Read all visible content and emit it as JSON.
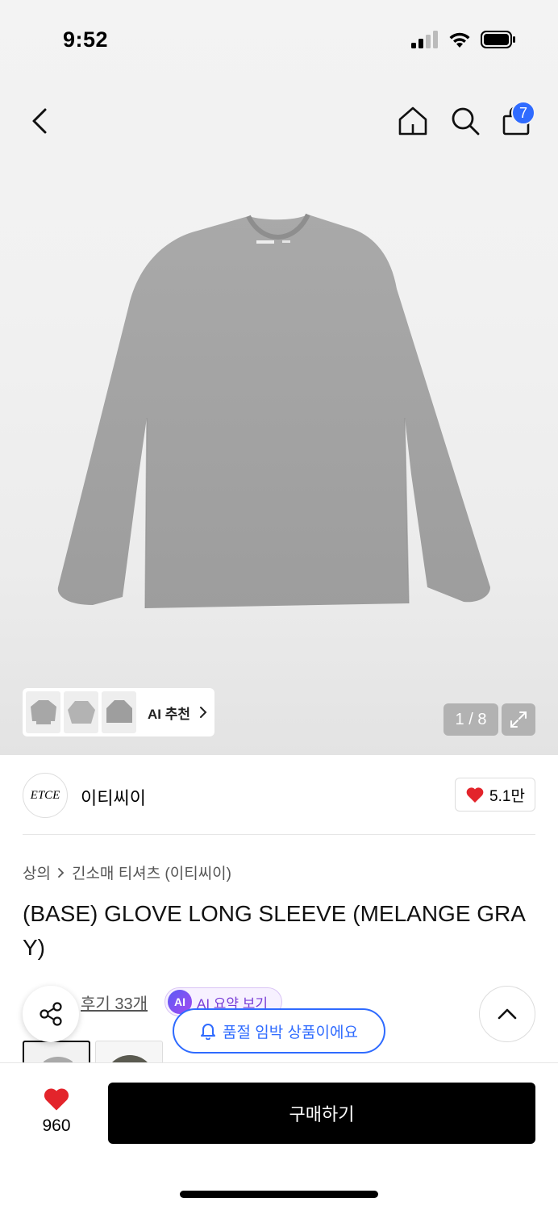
{
  "status_bar": {
    "time": "9:52"
  },
  "nav": {
    "cart_count": "7",
    "icons": [
      "back-icon",
      "home-icon",
      "search-icon",
      "shopping-bag-icon"
    ]
  },
  "gallery": {
    "page_counter": "1 / 8",
    "ai_recommend_label": "AI 추천"
  },
  "brand": {
    "logo_text": "ETCE",
    "name": "이티씨이",
    "likes": "5.1만"
  },
  "breadcrumb": {
    "level1": "상의",
    "level2": "긴소매 티셔츠 (이티씨이)"
  },
  "product": {
    "title": "(BASE) GLOVE LONG SLEEVE (MELANGE GRAY)"
  },
  "reviews": {
    "link_label": "후기 33개",
    "ai_badge": "AI",
    "ai_summary_label": "AI 요약 보기"
  },
  "toast": {
    "label": "품절 임박 상품이에요"
  },
  "bottom_bar": {
    "wish_count": "960",
    "buy_label": "구매하기"
  },
  "colors": {
    "accent_blue": "#2f6bff",
    "heart_red": "#e3242b",
    "buy_button": "#000000",
    "ai_purple": "#7a3fd6"
  }
}
